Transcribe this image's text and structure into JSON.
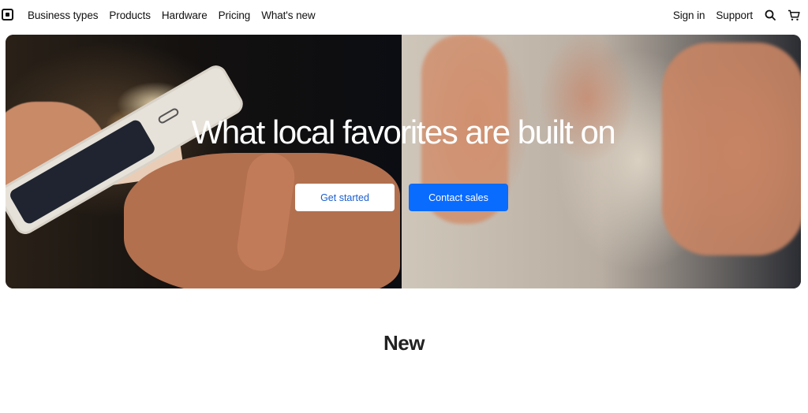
{
  "nav": {
    "links": [
      "Business types",
      "Products",
      "Hardware",
      "Pricing",
      "What's new"
    ],
    "sign_in": "Sign in",
    "support": "Support",
    "icons": {
      "logo": "square-logo-icon",
      "search": "search-icon",
      "cart": "cart-icon"
    }
  },
  "hero": {
    "headline": "What local favorites are built on",
    "primary_button": "Get started",
    "secondary_button": "Contact sales"
  },
  "section": {
    "title": "New"
  },
  "colors": {
    "accent": "#0a6bff",
    "text": "#111111",
    "background": "#ffffff"
  }
}
